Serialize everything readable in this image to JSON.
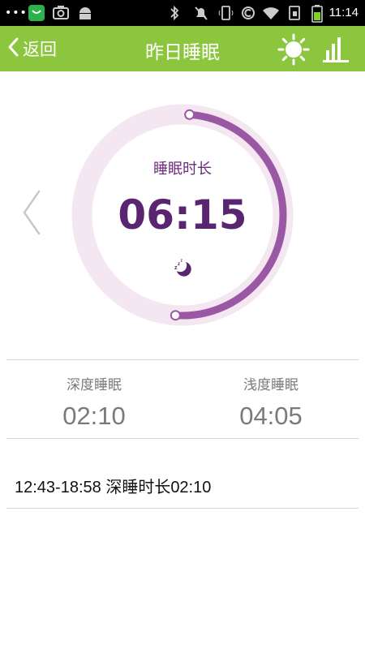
{
  "status_bar": {
    "dots": "•••",
    "time": "11:14",
    "icons": [
      "app-store-icon",
      "camera-icon",
      "android-icon",
      "bluetooth-icon",
      "silent-icon",
      "vibrate-icon",
      "data-icon",
      "wifi-icon",
      "sim-icon",
      "battery-icon"
    ]
  },
  "app_bar": {
    "back_label": "返回",
    "title": "昨日睡眠",
    "icons": [
      "sun-icon",
      "bar-chart-icon"
    ]
  },
  "ring": {
    "label": "睡眠时长",
    "value": "06:15",
    "progress": 0.5,
    "track_color": "#f4e7f2",
    "arc_color": "#9a58a4"
  },
  "stats": {
    "deep": {
      "title": "深度睡眠",
      "value": "02:10"
    },
    "light": {
      "title": "浅度睡眠",
      "value": "04:05"
    }
  },
  "records": [
    {
      "text": "12:43-18:58  深睡时长02:10"
    }
  ],
  "colors": {
    "accent": "#8cc63e",
    "text_purple": "#5a2570",
    "muted": "#7a7a7a"
  }
}
